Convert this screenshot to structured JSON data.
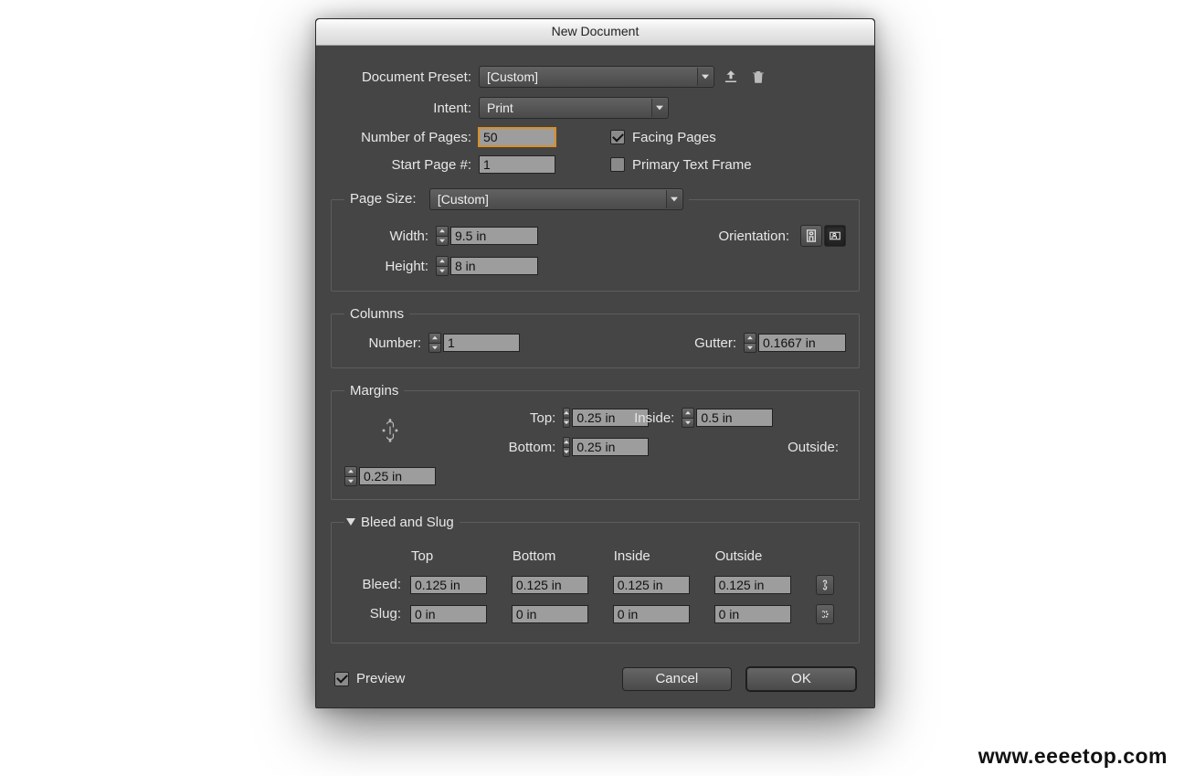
{
  "window": {
    "title": "New Document"
  },
  "preset": {
    "label": "Document Preset:",
    "value": "[Custom]",
    "save_icon": "save-preset-icon",
    "delete_icon": "delete-preset-icon"
  },
  "intent": {
    "label": "Intent:",
    "value": "Print"
  },
  "pages": {
    "label": "Number of Pages:",
    "value": "50"
  },
  "facing": {
    "label": "Facing Pages",
    "checked": true
  },
  "startpage": {
    "label": "Start Page #:",
    "value": "1"
  },
  "primaryframe": {
    "label": "Primary Text Frame",
    "checked": false
  },
  "pagesize": {
    "legend": "Page Size:",
    "value": "[Custom]",
    "width": {
      "label": "Width:",
      "value": "9.5 in"
    },
    "height": {
      "label": "Height:",
      "value": "8 in"
    },
    "orientation": {
      "label": "Orientation:",
      "active": "landscape"
    }
  },
  "columns": {
    "legend": "Columns",
    "number": {
      "label": "Number:",
      "value": "1"
    },
    "gutter": {
      "label": "Gutter:",
      "value": "0.1667 in"
    }
  },
  "margins": {
    "legend": "Margins",
    "top": {
      "label": "Top:",
      "value": "0.25 in"
    },
    "bottom": {
      "label": "Bottom:",
      "value": "0.25 in"
    },
    "inside": {
      "label": "Inside:",
      "value": "0.5 in"
    },
    "outside": {
      "label": "Outside:",
      "value": "0.25 in"
    }
  },
  "bleedslug": {
    "legend": "Bleed and Slug",
    "headers": {
      "top": "Top",
      "bottom": "Bottom",
      "inside": "Inside",
      "outside": "Outside"
    },
    "bleed": {
      "label": "Bleed:",
      "top": "0.125 in",
      "bottom": "0.125 in",
      "inside": "0.125 in",
      "outside": "0.125 in"
    },
    "slug": {
      "label": "Slug:",
      "top": "0 in",
      "bottom": "0 in",
      "inside": "0 in",
      "outside": "0 in"
    }
  },
  "footer": {
    "preview": {
      "label": "Preview",
      "checked": true
    },
    "cancel": "Cancel",
    "ok": "OK"
  },
  "watermark": "www.eeeetop.com"
}
